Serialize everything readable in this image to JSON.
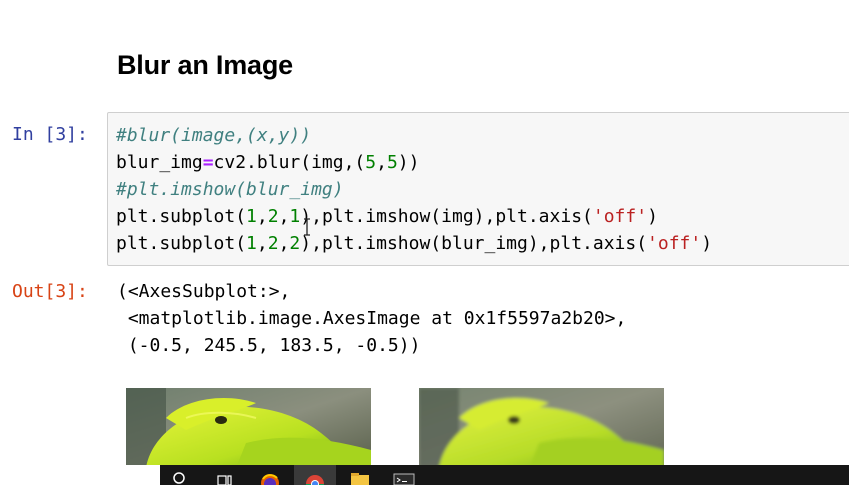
{
  "heading": "Blur an Image",
  "input_prompt": "In [3]:",
  "output_prompt": "Out[3]:",
  "code_lines": [
    [
      {
        "t": "#blur(image,(x,y))",
        "c": "cm"
      }
    ],
    [
      {
        "t": "blur_img",
        "c": ""
      },
      {
        "t": "=",
        "c": "op"
      },
      {
        "t": "cv2.blur(img,(",
        "c": ""
      },
      {
        "t": "5",
        "c": "num"
      },
      {
        "t": ",",
        "c": ""
      },
      {
        "t": "5",
        "c": "num"
      },
      {
        "t": "))",
        "c": ""
      }
    ],
    [
      {
        "t": "#plt.imshow(blur_img)",
        "c": "cm"
      }
    ],
    [
      {
        "t": "plt.subplot(",
        "c": ""
      },
      {
        "t": "1",
        "c": "num"
      },
      {
        "t": ",",
        "c": ""
      },
      {
        "t": "2",
        "c": "num"
      },
      {
        "t": ",",
        "c": ""
      },
      {
        "t": "1",
        "c": "num"
      },
      {
        "t": "),plt.imshow(img),plt.axis(",
        "c": ""
      },
      {
        "t": "'off'",
        "c": "str"
      },
      {
        "t": ")",
        "c": ""
      }
    ],
    [
      {
        "t": "plt.subplot(",
        "c": ""
      },
      {
        "t": "1",
        "c": "num"
      },
      {
        "t": ",",
        "c": ""
      },
      {
        "t": "2",
        "c": "num"
      },
      {
        "t": ",",
        "c": ""
      },
      {
        "t": "2",
        "c": "num"
      },
      {
        "t": "),plt.imshow(blur_img),plt.axis(",
        "c": ""
      },
      {
        "t": "'off'",
        "c": "str"
      },
      {
        "t": ")",
        "c": ""
      }
    ]
  ],
  "output_lines": [
    "(<AxesSubplot:>,",
    " <matplotlib.image.AxesImage at 0x1f5597a2b20>,",
    " (-0.5, 245.5, 183.5, -0.5))"
  ],
  "colors": {
    "in_prompt": "#303f9f",
    "out_prompt": "#d84315",
    "cell_background": "#f7f7f7",
    "comment": "#408080",
    "number": "#008000",
    "string": "#ba2121",
    "operator": "#aa22ff"
  },
  "figure": {
    "images": [
      "original-snake-image",
      "blurred-snake-image"
    ]
  },
  "taskbar": {
    "icons": [
      "search-icon",
      "task-view-icon",
      "firefox-icon",
      "chrome-icon",
      "file-explorer-icon",
      "terminal-icon"
    ]
  }
}
